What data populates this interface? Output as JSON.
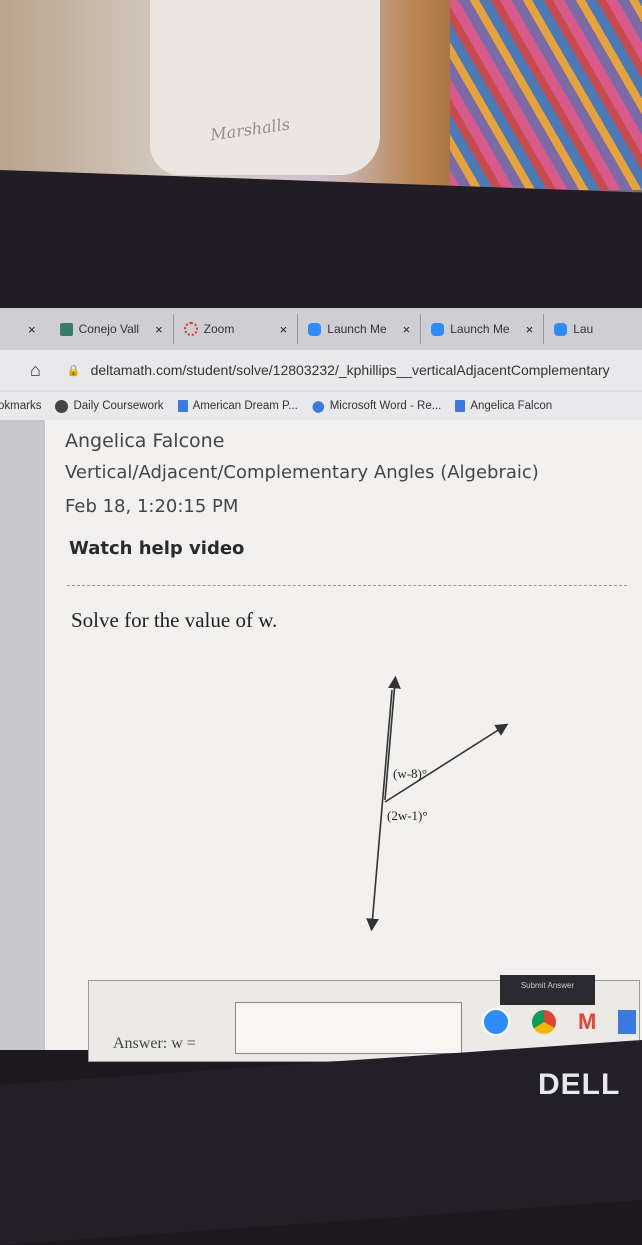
{
  "photo": {
    "bag_logo": "Marshalls"
  },
  "browser": {
    "tabs": [
      {
        "label": "Conejo Vall",
        "icon": "school-icon"
      },
      {
        "label": "Zoom",
        "icon": "zoom-loading-icon"
      },
      {
        "label": "Launch Me",
        "icon": "zoom-video-icon"
      },
      {
        "label": "Launch Me",
        "icon": "zoom-video-icon"
      },
      {
        "label": "Lau",
        "icon": "zoom-video-icon"
      }
    ],
    "close_glyph": "×",
    "url": "deltamath.com/student/solve/12803232/_kphillips__verticalAdjacentComplementary",
    "bookmarks_label": "okmarks",
    "bookmarks": [
      {
        "label": "Daily Coursework",
        "icon": "globe-icon"
      },
      {
        "label": "American Dream P...",
        "icon": "doc-icon"
      },
      {
        "label": "Microsoft Word - Re...",
        "icon": "map-pin-icon"
      },
      {
        "label": "Angelica Falcon",
        "icon": "doc-icon"
      }
    ]
  },
  "problem": {
    "student_name": "Angelica Falcone",
    "assignment": "Vertical/Adjacent/Complementary Angles (Algebraic)",
    "datetime": "Feb 18, 1:20:15 PM",
    "help_link": "Watch help video",
    "prompt": "Solve for the value of w.",
    "angle_top": "(w-8)°",
    "angle_bottom": "(2w-1)°",
    "answer_label": "Answer: w =",
    "submit_label": "Submit Answer"
  },
  "device": {
    "brand": "DELL"
  }
}
